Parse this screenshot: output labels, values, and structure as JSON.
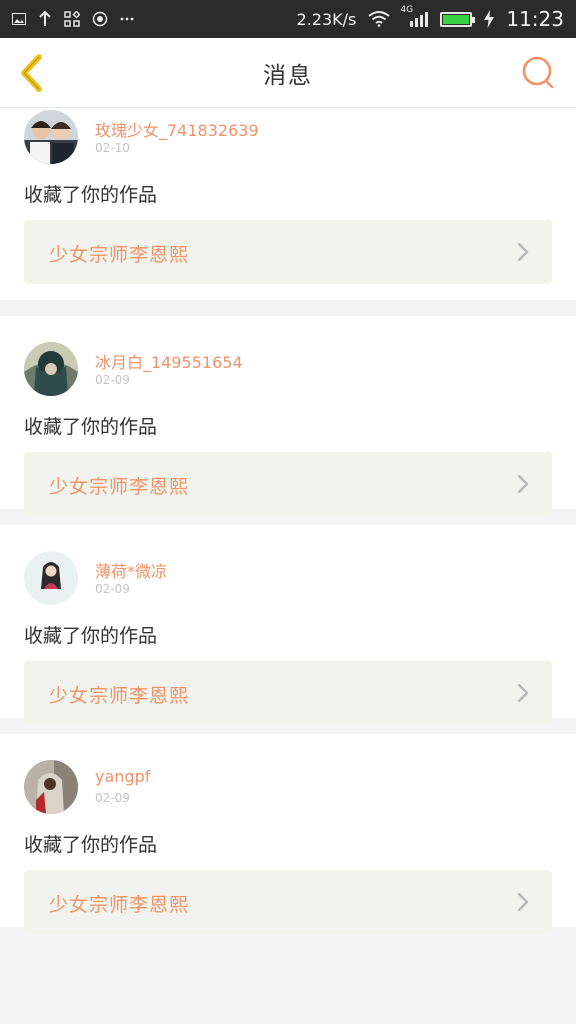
{
  "status_bar": {
    "speed": "2.23K/s",
    "network": "4G",
    "time": "11:23",
    "icons": [
      "image-icon",
      "upload-icon",
      "apps-icon",
      "record-icon",
      "more-icon",
      "wifi-icon",
      "signal-icon",
      "battery-icon",
      "charging-icon"
    ]
  },
  "nav": {
    "title": "消息",
    "back_icon": "chevron-left-icon",
    "search_icon": "search-icon"
  },
  "colors": {
    "accent": "#f0936a",
    "back_arrow": "#f2c21b",
    "card_box": "#f3f3ed",
    "battery": "#39d243"
  },
  "notifications": [
    {
      "username": "玫瑰少女_741832639",
      "date": "02-10",
      "action": "收藏了你的作品",
      "work_title": "少女宗师李恩熙"
    },
    {
      "username": "冰月白_149551654",
      "date": "02-09",
      "action": "收藏了你的作品",
      "work_title": "少女宗师李恩熙"
    },
    {
      "username": "薄荷*微凉",
      "date": "02-09",
      "action": "收藏了你的作品",
      "work_title": "少女宗师李恩熙"
    },
    {
      "username": "yangpf",
      "date": "02-09",
      "action": "收藏了你的作品",
      "work_title": "少女宗师李恩熙"
    }
  ]
}
